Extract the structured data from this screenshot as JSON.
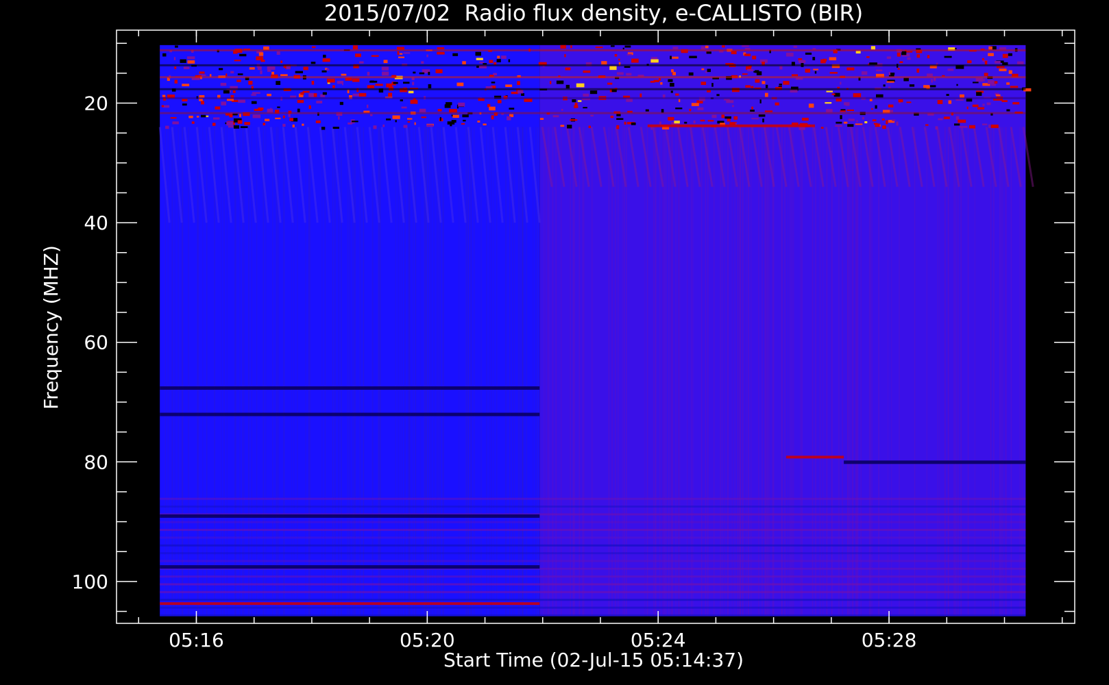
{
  "chart_data": {
    "type": "heatmap",
    "title": "2015/07/02  Radio flux density, e-CALLISTO (BIR)",
    "xlabel": "Start Time (02-Jul-15 05:14:37)",
    "ylabel": "Frequency (MHZ)",
    "x_start": "05:14:37",
    "xlim_minutes": [
      0,
      16.6
    ],
    "ylim": [
      107,
      7.8
    ],
    "y_inverted": true,
    "data_start_minute": 0.75,
    "data_end_minute": 15.75,
    "freq_min": 10.3,
    "freq_max": 105.8,
    "x_ticks": [
      {
        "minute": 1.383,
        "label": "05:16"
      },
      {
        "minute": 5.383,
        "label": "05:20"
      },
      {
        "minute": 9.383,
        "label": "05:24"
      },
      {
        "minute": 13.383,
        "label": "05:28"
      }
    ],
    "x_minor_tick_step_minutes": 1,
    "x_minor_tick_first": 0.383,
    "y_ticks": [
      20,
      40,
      60,
      80,
      100
    ],
    "y_minor_tick_step": 5,
    "background_change_minute": 7.33,
    "colors": {
      "background": "#000000",
      "axes": "#ffffff",
      "low": "#1a10ff",
      "mid": "#5a10c8",
      "high": "#d00000",
      "max": "#ffd020"
    },
    "features": [
      {
        "kind": "interference",
        "freq_from": 10.3,
        "freq_to": 24,
        "minute_from": 0.75,
        "minute_to": 15.75
      },
      {
        "kind": "dark_band",
        "freq": 67.6,
        "minute_from": 0.75,
        "minute_to": 7.33
      },
      {
        "kind": "dark_band",
        "freq": 72,
        "minute_from": 0.75,
        "minute_to": 7.33
      },
      {
        "kind": "dark_band",
        "freq": 89,
        "minute_from": 0.75,
        "minute_to": 7.33
      },
      {
        "kind": "dark_band",
        "freq": 97.5,
        "minute_from": 0.75,
        "minute_to": 7.33
      },
      {
        "kind": "dark_band",
        "freq": 80,
        "minute_from": 12.6,
        "minute_to": 15.75
      },
      {
        "kind": "bright_band",
        "freq": 103.7,
        "minute_from": 0.75,
        "minute_to": 7.33
      },
      {
        "kind": "bright_band",
        "freq": 23.8,
        "minute_from": 9.2,
        "minute_to": 12.1
      },
      {
        "kind": "bright_band",
        "freq": 79.2,
        "minute_from": 11.6,
        "minute_to": 12.6
      }
    ]
  }
}
